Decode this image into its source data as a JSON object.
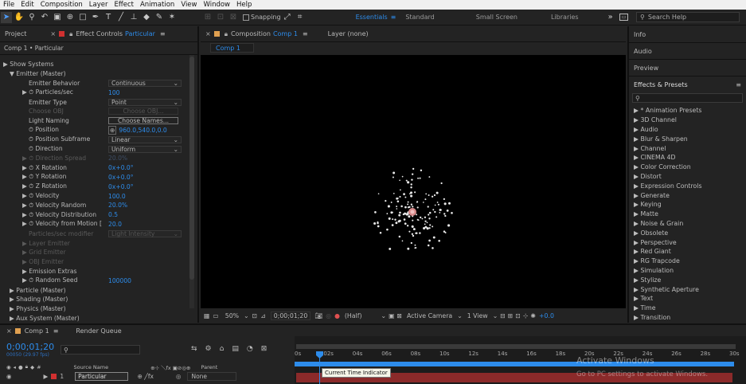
{
  "menu": [
    "File",
    "Edit",
    "Composition",
    "Layer",
    "Effect",
    "Animation",
    "View",
    "Window",
    "Help"
  ],
  "toolbar": {
    "snapping": "Snapping",
    "workspaces": [
      "Essentials",
      "Standard",
      "Small Screen",
      "Libraries"
    ],
    "search_placeholder": "Search Help"
  },
  "project_tab": "Project",
  "effect_controls": {
    "tab_prefix": "Effect Controls",
    "tab_layer": "Particular",
    "breadcrumb": "Comp 1 • Particular",
    "rows": [
      {
        "label": "▶ Show Systems",
        "value": "",
        "indent": 0,
        "dim": false
      },
      {
        "label": "▼ Emitter (Master)",
        "value": "",
        "indent": 1,
        "dim": false
      },
      {
        "label": "Emitter Behavior",
        "value": "Continuous",
        "indent": 4,
        "dim": false
      },
      {
        "label": "▶ ⏱ Particles/sec",
        "value": "100",
        "indent": 3,
        "dim": false
      },
      {
        "label": "Emitter Type",
        "value": "Point",
        "indent": 4,
        "dim": false
      },
      {
        "label": "Choose OBJ",
        "value": "Choose OBJ...",
        "indent": 4,
        "dim": true
      },
      {
        "label": "Light Naming",
        "value": "Choose Names...",
        "indent": 4,
        "dim": false
      },
      {
        "label": "⏱ Position",
        "value": "960.0,540.0,0.0",
        "indent": 4,
        "dim": false
      },
      {
        "label": "⏱ Position Subframe",
        "value": "Linear",
        "indent": 4,
        "dim": false
      },
      {
        "label": "⏱ Direction",
        "value": "Uniform",
        "indent": 4,
        "dim": false
      },
      {
        "label": "▶ ⏱ Direction Spread",
        "value": "20.0%",
        "indent": 3,
        "dim": true
      },
      {
        "label": "▶ ⏱ X Rotation",
        "value": "0x+0.0°",
        "indent": 3,
        "dim": false
      },
      {
        "label": "▶ ⏱ Y Rotation",
        "value": "0x+0.0°",
        "indent": 3,
        "dim": false
      },
      {
        "label": "▶ ⏱ Z Rotation",
        "value": "0x+0.0°",
        "indent": 3,
        "dim": false
      },
      {
        "label": "▶ ⏱ Velocity",
        "value": "100.0",
        "indent": 3,
        "dim": false
      },
      {
        "label": "▶ ⏱ Velocity Random",
        "value": "20.0%",
        "indent": 3,
        "dim": false
      },
      {
        "label": "▶ ⏱ Velocity Distribution",
        "value": "0.5",
        "indent": 3,
        "dim": false
      },
      {
        "label": "▶ ⏱ Velocity from Motion [",
        "value": "20.0",
        "indent": 3,
        "dim": false
      },
      {
        "label": "Particles/sec modifier",
        "value": "Light Intensity",
        "indent": 4,
        "dim": true
      },
      {
        "label": "▶ Layer Emitter",
        "value": "",
        "indent": 3,
        "dim": true
      },
      {
        "label": "▶ Grid Emitter",
        "value": "",
        "indent": 3,
        "dim": true
      },
      {
        "label": "▶ OBJ Emitter",
        "value": "",
        "indent": 3,
        "dim": true
      },
      {
        "label": "▶ Emission Extras",
        "value": "",
        "indent": 3,
        "dim": false
      },
      {
        "label": "▶ ⏱ Random Seed",
        "value": "100000",
        "indent": 3,
        "dim": false
      },
      {
        "label": "▶ Particle (Master)",
        "value": "",
        "indent": 1,
        "dim": false
      },
      {
        "label": "▶ Shading (Master)",
        "value": "",
        "indent": 1,
        "dim": false
      },
      {
        "label": "▶ Physics (Master)",
        "value": "",
        "indent": 1,
        "dim": false
      },
      {
        "label": "▶ Aux System (Master)",
        "value": "",
        "indent": 1,
        "dim": false
      }
    ]
  },
  "composition": {
    "tab_prefix": "Composition",
    "tab_comp": "Comp 1",
    "layer_tab": "Layer (none)",
    "comp_chip": "Comp 1",
    "bottom": {
      "zoom": "50%",
      "timecode": "0;00;01;20",
      "resolution": "(Half)",
      "camera": "Active Camera",
      "view": "1 View",
      "exposure": "+0.0"
    }
  },
  "right_panel": {
    "info": "Info",
    "audio": "Audio",
    "preview": "Preview",
    "effects_title": "Effects & Presets",
    "categories": [
      "▶ * Animation Presets",
      "▶ 3D Channel",
      "▶ Audio",
      "▶ Blur & Sharpen",
      "▶ Channel",
      "▶ CINEMA 4D",
      "▶ Color Correction",
      "▶ Distort",
      "▶ Expression Controls",
      "▶ Generate",
      "▶ Keying",
      "▶ Matte",
      "▶ Noise & Grain",
      "▶ Obsolete",
      "▶ Perspective",
      "▶ Red Giant",
      "▶ RG Trapcode",
      "▶ Simulation",
      "▶ Stylize",
      "▶ Synthetic Aperture",
      "▶ Text",
      "▶ Time",
      "▶ Transition"
    ]
  },
  "timeline": {
    "tab": "Comp 1",
    "render_queue": "Render Queue",
    "timecode": "0;00;01;20",
    "frame_info": "00050 (29.97 fps)",
    "col_source": "Source Name",
    "col_parent": "Parent",
    "layer_num": "1",
    "layer_name": "Particular",
    "parent_value": "None",
    "ticks": [
      "0s",
      "02s",
      "04s",
      "06s",
      "08s",
      "10s",
      "12s",
      "14s",
      "16s",
      "18s",
      "20s",
      "22s",
      "24s",
      "26s",
      "28s",
      "30s"
    ],
    "tooltip": "Current Time Indicator",
    "watermark_1": "Activate Windows",
    "watermark_2": "Go to PC settings to activate Windows."
  }
}
